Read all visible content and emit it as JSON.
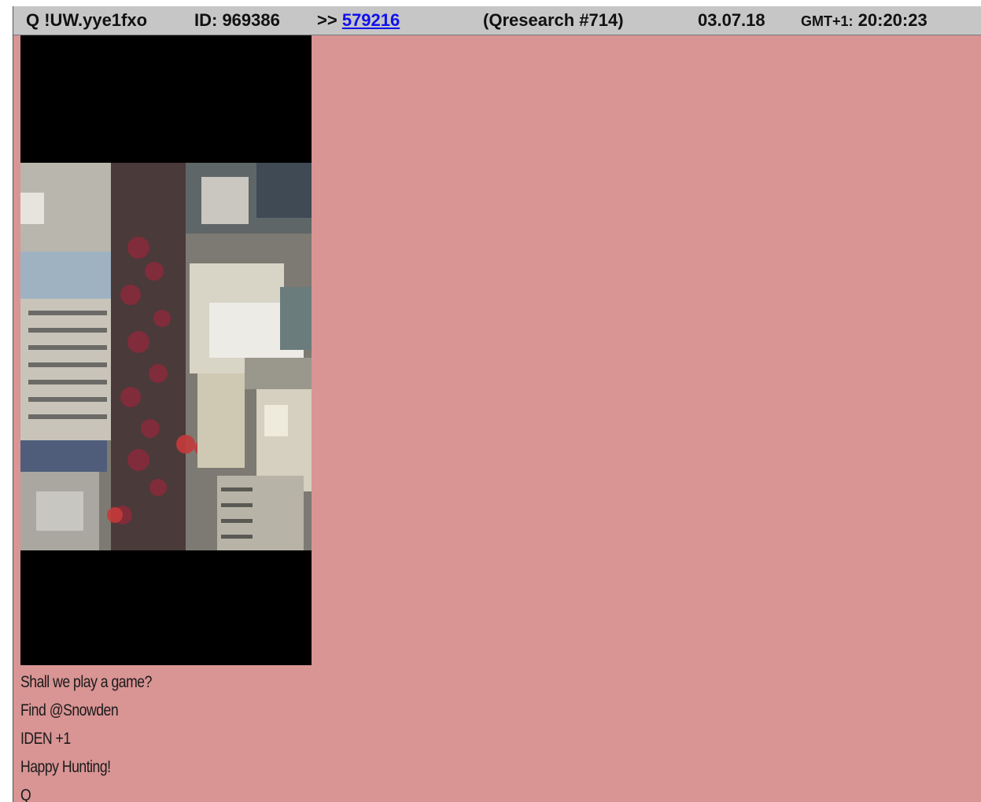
{
  "post": {
    "header": {
      "author": "Q !UW.yye1fxo",
      "id": "ID: 969386",
      "reply_prefix": ">>",
      "reply_link": "579216",
      "thread": "(Qresearch #714)",
      "date": "03.07.18",
      "time_zone": "GMT+1:",
      "time": "20:20:23"
    },
    "image": {
      "alt": "aerial-city-street-crowd"
    },
    "body_lines": [
      "Shall we play a game?",
      "Find @Snowden",
      "IDEN +1",
      "Happy Hunting!",
      "Q"
    ]
  },
  "colors": {
    "post_background": "#d99494",
    "header_background": "#c6c6c6",
    "link": "#1010ee"
  }
}
